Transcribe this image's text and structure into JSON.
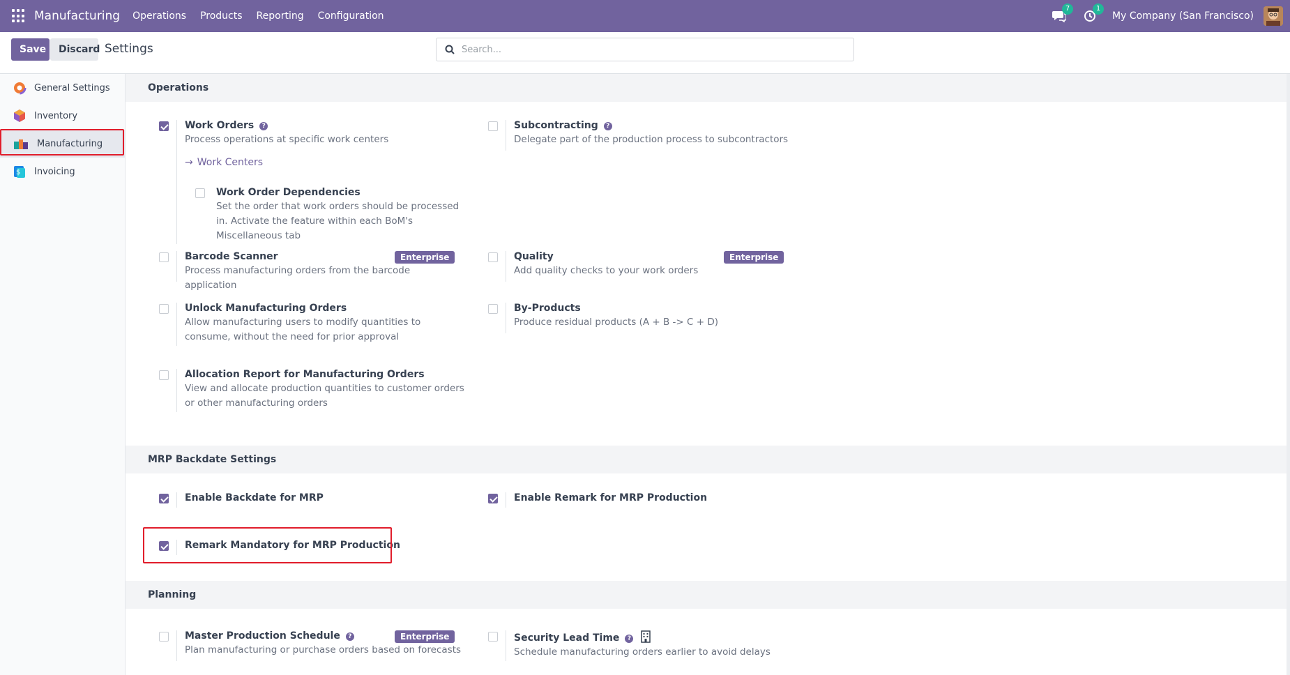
{
  "navbar": {
    "brand": "Manufacturing",
    "menu": [
      "Operations",
      "Products",
      "Reporting",
      "Configuration"
    ],
    "messages_count": "7",
    "activities_count": "1",
    "company": "My Company (San Francisco)"
  },
  "control_panel": {
    "save_label": "Save",
    "discard_label": "Discard",
    "title": "Settings",
    "search_placeholder": "Search..."
  },
  "sidebar": {
    "items": [
      {
        "label": "General Settings",
        "icon": "general-settings-icon"
      },
      {
        "label": "Inventory",
        "icon": "inventory-icon"
      },
      {
        "label": "Manufacturing",
        "icon": "manufacturing-icon",
        "active": true
      },
      {
        "label": "Invoicing",
        "icon": "invoicing-icon"
      }
    ]
  },
  "sections": {
    "operations": {
      "title": "Operations",
      "work_orders": {
        "title": "Work Orders",
        "desc": "Process operations at specific work centers",
        "checked": true
      },
      "work_centers_link": "Work Centers",
      "work_order_dependencies": {
        "title": "Work Order Dependencies",
        "desc": "Set the order that work orders should be processed in. Activate the feature within each BoM's Miscellaneous tab",
        "checked": false
      },
      "subcontracting": {
        "title": "Subcontracting",
        "desc": "Delegate part of the production process to subcontractors",
        "checked": false
      },
      "barcode_scanner": {
        "title": "Barcode Scanner",
        "desc": "Process manufacturing orders from the barcode application",
        "badge": "Enterprise",
        "checked": false
      },
      "quality": {
        "title": "Quality",
        "desc": "Add quality checks to your work orders",
        "badge": "Enterprise",
        "checked": false
      },
      "unlock_mo": {
        "title": "Unlock Manufacturing Orders",
        "desc": "Allow manufacturing users to modify quantities to consume, without the need for prior approval",
        "checked": false
      },
      "by_products": {
        "title": "By-Products",
        "desc": "Produce residual products (A + B -> C + D)",
        "checked": false
      },
      "allocation_report": {
        "title": "Allocation Report for Manufacturing Orders",
        "desc": "View and allocate production quantities to customer orders or other manufacturing orders",
        "checked": false
      }
    },
    "backdate": {
      "title": "MRP Backdate Settings",
      "enable_backdate": {
        "title": "Enable Backdate for MRP",
        "checked": true
      },
      "enable_remark": {
        "title": "Enable Remark for MRP Production",
        "checked": true
      },
      "remark_mandatory": {
        "title": "Remark Mandatory for MRP Production",
        "checked": true
      }
    },
    "planning": {
      "title": "Planning",
      "mps": {
        "title": "Master Production Schedule",
        "desc": "Plan manufacturing or purchase orders based on forecasts",
        "badge": "Enterprise",
        "checked": false
      },
      "security_lead_time": {
        "title": "Security Lead Time",
        "desc": "Schedule manufacturing orders earlier to avoid delays",
        "checked": false
      }
    }
  },
  "colors": {
    "brand": "#71639e",
    "highlight": "#e11d2b",
    "badge_green": "#21b799"
  }
}
